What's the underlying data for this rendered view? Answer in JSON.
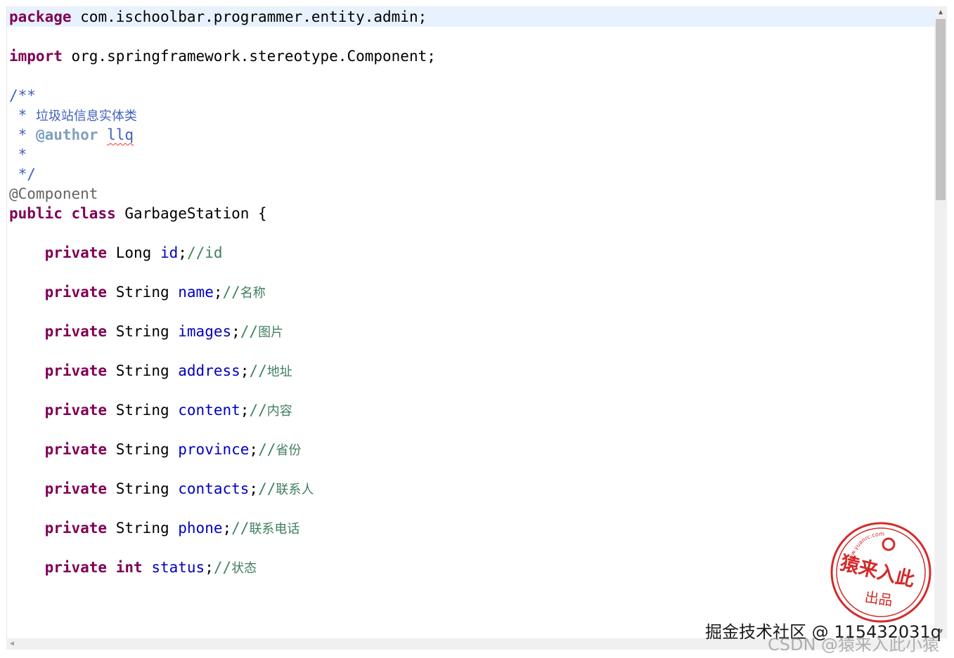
{
  "code": {
    "package": {
      "keyword": "package",
      "name": " com.ischoolbar.programmer.entity.admin;"
    },
    "import": {
      "keyword": "import",
      "name": " org.springframework.stereotype.Component;"
    },
    "javadoc": {
      "open": "/**",
      "star": " * ",
      "description": "垃圾站信息实体类",
      "author_tag": "@author",
      "author_name": "llq",
      "blank": " *",
      "close": " */"
    },
    "annotation": "@Component",
    "class_decl": {
      "public": "public",
      "class": "class",
      "name": " GarbageStation {"
    },
    "fields": [
      {
        "modifier": "private",
        "type": "Long",
        "name": "id",
        "comment": "//id",
        "cjk": false
      },
      {
        "modifier": "private",
        "type": "String",
        "name": "name",
        "comment_prefix": "//",
        "comment": "名称",
        "cjk": true
      },
      {
        "modifier": "private",
        "type": "String",
        "name": "images",
        "comment_prefix": "//",
        "comment": "图片",
        "cjk": true
      },
      {
        "modifier": "private",
        "type": "String",
        "name": "address",
        "comment_prefix": "//",
        "comment": "地址",
        "cjk": true
      },
      {
        "modifier": "private",
        "type": "String",
        "name": "content",
        "comment_prefix": "//",
        "comment": "内容",
        "cjk": true
      },
      {
        "modifier": "private",
        "type": "String",
        "name": "province",
        "comment_prefix": "//",
        "comment": "省份",
        "cjk": true
      },
      {
        "modifier": "private",
        "type": "String",
        "name": "contacts",
        "comment_prefix": "//",
        "comment": "联系人",
        "cjk": true
      },
      {
        "modifier": "private",
        "type": "String",
        "name": "phone",
        "comment_prefix": "//",
        "comment": "联系电话",
        "cjk": true
      },
      {
        "modifier": "private",
        "type": "int",
        "name": "status",
        "comment_prefix": "//",
        "comment": "状态",
        "cjk": true
      }
    ]
  },
  "stamp": {
    "url": "www.yuanrc.com",
    "main": "猿来入此",
    "sub": "出品",
    "color": "#d42a2a"
  },
  "watermarks": {
    "juejin": "掘金技术社区 @ 115432031q",
    "csdn": "CSDN @猿来入此小猿"
  },
  "colors": {
    "keyword": "#7f0055",
    "field": "#0000c0",
    "comment": "#3f7f5f",
    "javadoc": "#3f5fbf",
    "current_line": "#e8f2fe"
  }
}
